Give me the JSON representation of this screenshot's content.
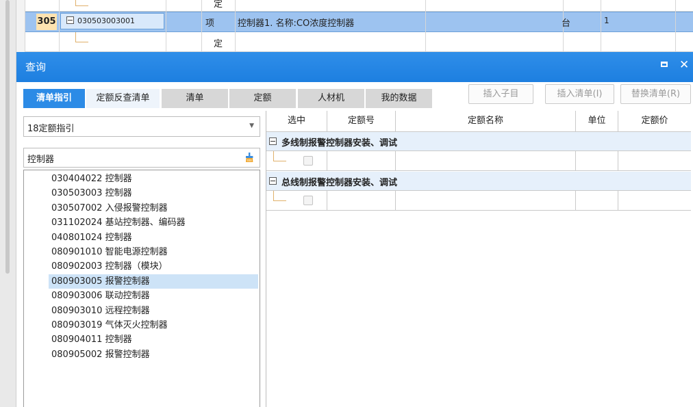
{
  "background_sheet": {
    "top_row": {
      "type": "定"
    },
    "selected_row": {
      "row_number": "305",
      "code": "030503003001",
      "type": "项",
      "description": "控制器1. 名称:CO浓度控制器",
      "unit": "台",
      "quantity": "1"
    },
    "next_row": {
      "type": "定"
    }
  },
  "dialog": {
    "title": "查询",
    "tabs": [
      {
        "label": "清单指引",
        "state": "active"
      },
      {
        "label": "定额反查清单",
        "state": "light"
      },
      {
        "label": "清单",
        "state": "grey"
      },
      {
        "label": "定额",
        "state": "grey"
      },
      {
        "label": "人材机",
        "state": "grey"
      },
      {
        "label": "我的数据",
        "state": "grey"
      }
    ],
    "toolbar_buttons": {
      "insert_child": "插入子目",
      "insert_list": "插入清单(I)",
      "replace_list": "替换清单(R)"
    },
    "left": {
      "combo_value": "18定额指引",
      "search_value": "控制器",
      "list_items": [
        "030404022 控制器",
        "030503003 控制器",
        "030507002 入侵报警控制器",
        "031102024 基站控制器、编码器",
        "040801024 控制器",
        "080901010 智能电源控制器",
        "080902003 控制器（模块）",
        "080903005 报警控制器",
        "080903006 联动控制器",
        "080903010 远程控制器",
        "080903019 气体灭火控制器",
        "080904011 控制器",
        "080905002 报警控制器"
      ],
      "selected_index": 7
    },
    "right": {
      "columns": [
        "选中",
        "定额号",
        "定额名称",
        "单位",
        "定额价"
      ],
      "groups": [
        {
          "label": "多线制报警控制器安装、调试"
        },
        {
          "label": "总线制报警控制器安装、调试"
        }
      ]
    }
  },
  "colors": {
    "title_bar": "#1d7fe0",
    "active_tab": "#2c8be6",
    "selected_row": "#9dc3f0",
    "row_number_bg": "#fde3b0",
    "group_row_bg": "#e6f0fb",
    "selected_list_item": "#cde3f7"
  }
}
